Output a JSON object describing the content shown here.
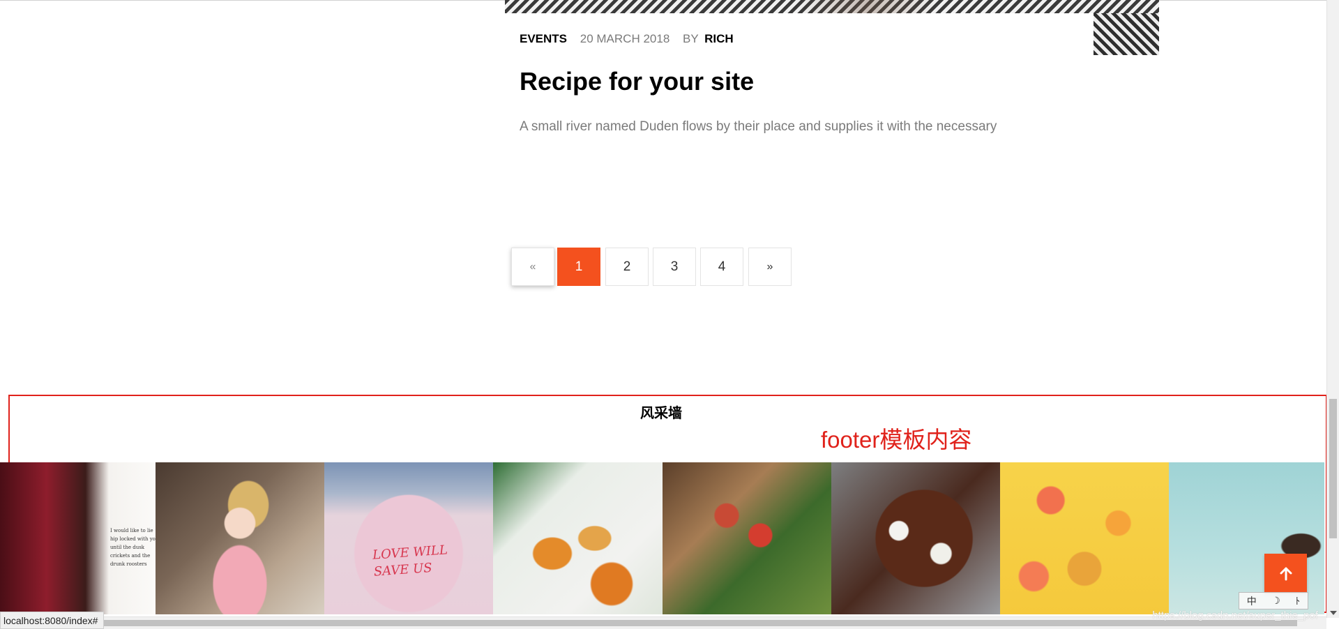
{
  "post": {
    "category": "EVENTS",
    "date": "20 MARCH 2018",
    "by_label": "BY",
    "author": "RICH",
    "title": "Recipe for your site",
    "excerpt": "A small river named Duden flows by their place and supplies it with the necessary"
  },
  "pagination": {
    "prev": "«",
    "pages": [
      "1",
      "2",
      "3",
      "4"
    ],
    "current": "1",
    "next": "»"
  },
  "footer": {
    "title": "风采墙",
    "annotation": "footer模板内容",
    "gallery_notes": {
      "note_text": "I would like to lie hip locked with you until the dusk crickets and the drunk roosters",
      "shirt_text_line1": "LOVE WILL",
      "shirt_text_line2": "SAVE US"
    }
  },
  "back_to_top": {
    "icon": "arrow-up-icon"
  },
  "ime": {
    "items": [
      "中",
      "☽",
      "ﾄ"
    ]
  },
  "status_bar": {
    "url": "localhost:8080/index#"
  },
  "watermark": "https://blog.csdn.net/super_thie_pof",
  "colors": {
    "accent": "#f4511e",
    "annotation": "#e0221b"
  }
}
